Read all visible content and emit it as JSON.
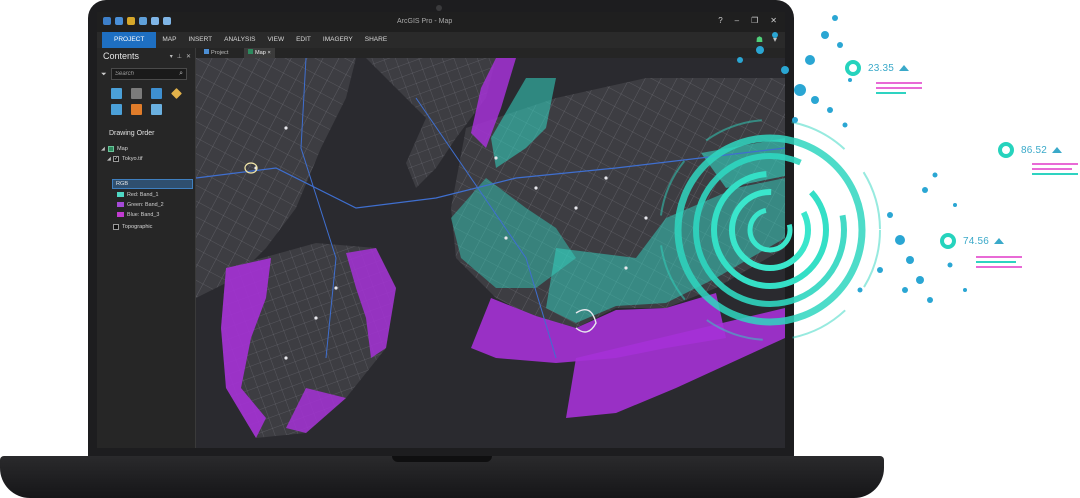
{
  "app": {
    "title": "ArcGIS Pro - Map"
  },
  "window_controls": [
    "?",
    "–",
    "❐",
    "✕"
  ],
  "ribbon": {
    "tabs": [
      "PROJECT",
      "MAP",
      "INSERT",
      "ANALYSIS",
      "VIEW",
      "EDIT",
      "IMAGERY",
      "SHARE"
    ],
    "active_tab": "PROJECT"
  },
  "contents": {
    "title": "Contents",
    "pane_controls": [
      "▾",
      "⊥",
      "✕"
    ],
    "search_placeholder": "Search",
    "drawing_order_label": "Drawing Order",
    "tree": {
      "map_label": "Map",
      "layer_label": "Tokyo.tif",
      "rgb_label": "RGB",
      "bands": [
        {
          "label": "Red:  Band_1",
          "color": "#4fd8c4"
        },
        {
          "label": "Green: Band_2",
          "color": "#a64ad8"
        },
        {
          "label": "Blue: Band_3",
          "color": "#c23bd1"
        }
      ],
      "basemap_label": "Topographic"
    }
  },
  "map_view": {
    "tabs": [
      "Project",
      "Map"
    ],
    "active_tab": "Map",
    "colors": {
      "land": "#3d3d42",
      "water": "#2a2a2f",
      "flood_purple": "#a531d6",
      "flood_teal": "#33d6c3",
      "roads": "#c9c9cf"
    }
  },
  "overlay_metrics": [
    {
      "value": "23.35",
      "trend": "up"
    },
    {
      "value": "86.52",
      "trend": "up"
    },
    {
      "value": "74.56",
      "trend": "up"
    }
  ],
  "accent_colors": {
    "ring": "#26d3bd",
    "bubble": "#2aa6d3",
    "lines_pink": "#e86ad6",
    "lines_cyan": "#2ed3c1"
  }
}
